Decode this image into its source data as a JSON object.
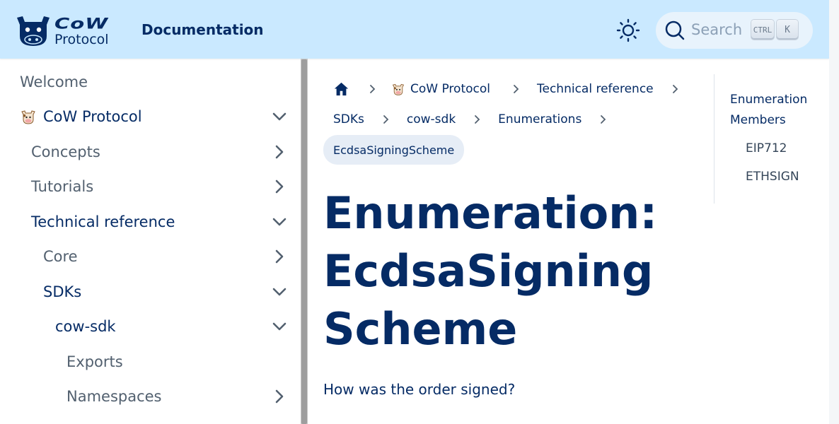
{
  "navbar": {
    "logo_word": "CoW",
    "logo_sub": "Protocol",
    "title": "Documentation",
    "search_placeholder": "Search",
    "kbd_ctrl": "CTRL",
    "kbd_k": "K",
    "icons": {
      "logo": "cow-logo-icon",
      "theme": "sun-icon",
      "search": "search-icon"
    }
  },
  "sidebar": {
    "items": [
      {
        "label": "Welcome"
      },
      {
        "label": "CoW Protocol",
        "expanded": true
      },
      {
        "label": "Concepts",
        "expanded": false
      },
      {
        "label": "Tutorials",
        "expanded": false
      },
      {
        "label": "Technical reference",
        "expanded": true
      },
      {
        "label": "Core",
        "expanded": false
      },
      {
        "label": "SDKs",
        "expanded": true
      },
      {
        "label": "cow-sdk",
        "expanded": true
      },
      {
        "label": "Exports"
      },
      {
        "label": "Namespaces",
        "expanded": false
      }
    ]
  },
  "breadcrumbs": {
    "items": [
      "CoW Protocol",
      "Technical reference",
      "SDKs",
      "cow-sdk",
      "Enumerations"
    ],
    "current": "EcdsaSigningScheme"
  },
  "page": {
    "title": "Enumeration: EcdsaSigningScheme",
    "description": "How was the order signed?"
  },
  "toc": {
    "heading": "Enumeration Members",
    "items": [
      "EIP712",
      "ETHSIGN"
    ]
  },
  "colors": {
    "navbar_bg": "#cae9ff",
    "primary_text": "#052b65",
    "sidebar_text": "#52606f",
    "search_bg": "#e8f3fc",
    "active_crumb_bg": "#e6edf6"
  }
}
